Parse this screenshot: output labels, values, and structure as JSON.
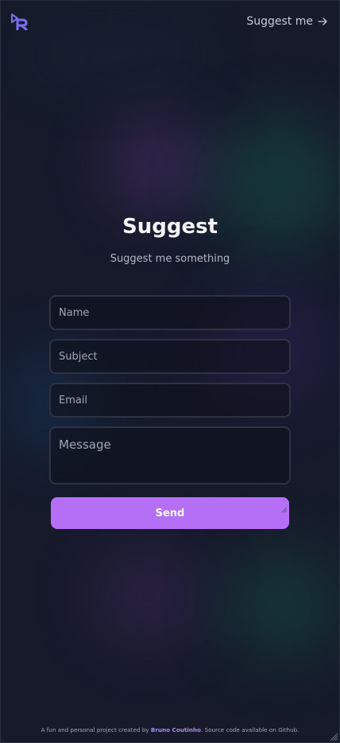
{
  "header": {
    "logo_icon": "dr-logo-icon",
    "suggest_link_label": "Suggest me",
    "suggest_link_icon": "arrow-right-icon"
  },
  "main": {
    "title": "Suggest",
    "subtitle": "Suggest me something"
  },
  "form": {
    "name_placeholder": "Name",
    "subject_placeholder": "Subject",
    "email_placeholder": "Email",
    "message_placeholder": "Message",
    "send_label": "Send"
  },
  "footer": {
    "text_before": "A fun and personal project created by ",
    "author": "Bruno Coutinho",
    "text_after": ". Source code available on Github."
  },
  "colors": {
    "background": "#161a2b",
    "accent": "#b46ff6",
    "logo": "#7b6ff0",
    "author_link": "#a98cf6"
  }
}
